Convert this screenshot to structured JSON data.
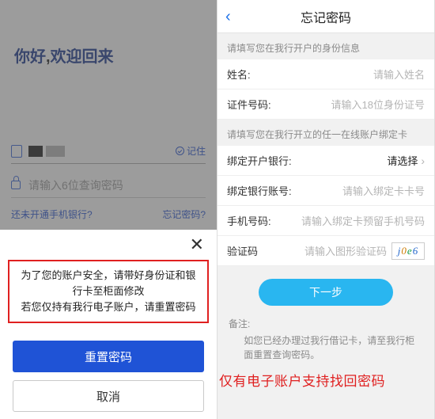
{
  "left": {
    "greeting_hello": "你好",
    "greeting_comma": ",",
    "greeting_welcome": "欢迎回来",
    "remember_label": "记住",
    "password_placeholder": "请输入6位查询密码",
    "link_not_opened": "还未开通手机银行?",
    "link_forgot": "忘记密码?",
    "sheet": {
      "close": "✕",
      "msg_line1": "为了您的账户安全，请带好身份证和银行卡至柜面修改",
      "msg_line2": "若您仅持有我行电子账户，请重置密码",
      "reset_btn": "重置密码",
      "cancel_btn": "取消"
    }
  },
  "right": {
    "back_glyph": "‹",
    "title": "忘记密码",
    "section_identity": "请填写您在我行开户的身份信息",
    "rows_identity": [
      {
        "label": "姓名:",
        "placeholder": "请输入姓名"
      },
      {
        "label": "证件号码:",
        "placeholder": "请输入18位身份证号"
      }
    ],
    "section_card": "请填写您在我行开立的任一在线账户绑定卡",
    "row_bank": {
      "label": "绑定开户银行:",
      "value": "请选择"
    },
    "rows_card": [
      {
        "label": "绑定银行账号:",
        "placeholder": "请输入绑定卡卡号"
      },
      {
        "label": "手机号码:",
        "placeholder": "请输入绑定卡预留手机号码"
      }
    ],
    "row_captcha": {
      "label": "验证码",
      "placeholder": "请输入图形验证码",
      "captcha": "j0e6"
    },
    "next_btn": "下一步",
    "remark_hd": "备注:",
    "remark_bd": "如您已经办理过我行借记卡，请至我行柜面重置查询密码。",
    "red_notice": "仅有电子账户支持找回密码"
  }
}
